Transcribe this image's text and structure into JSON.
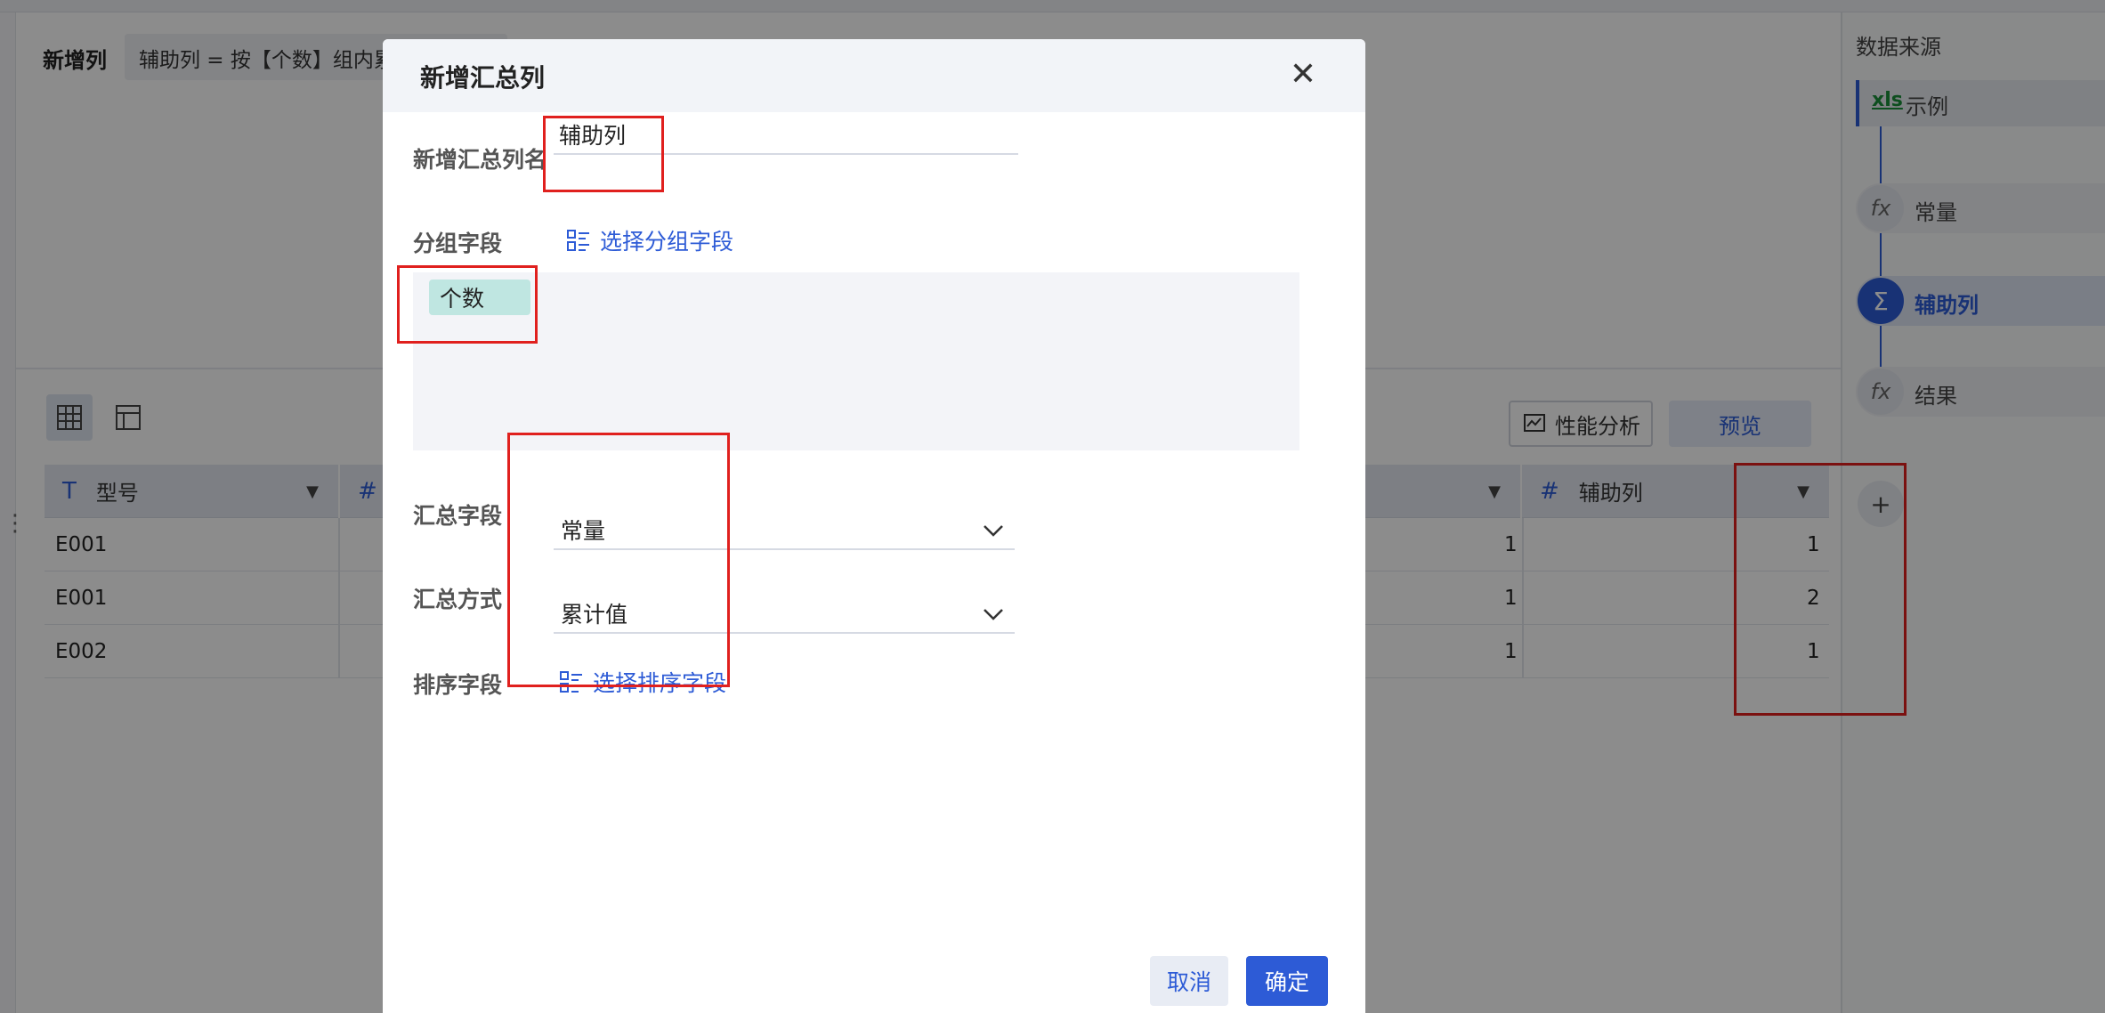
{
  "editor": {
    "formula_label": "新增列",
    "formula_text": "辅助列 = 按【个数】组内累计常量"
  },
  "table": {
    "columns": [
      {
        "type_icon": "T",
        "name": "型号"
      },
      {
        "type_icon": "#",
        "name": ""
      },
      {
        "type_icon": "#",
        "name": "辅助列"
      }
    ],
    "rows": [
      {
        "model": "E001",
        "hidden_value": "1",
        "helper": "1"
      },
      {
        "model": "E001",
        "hidden_value": "1",
        "helper": "2"
      },
      {
        "model": "E002",
        "hidden_value": "1",
        "helper": "1"
      }
    ]
  },
  "toolbar": {
    "perf_label": "性能分析",
    "preview_label": "预览"
  },
  "right_panel": {
    "title": "数据来源",
    "steps": [
      {
        "icon": "xls-icon",
        "label": "示例"
      },
      {
        "icon": "fx-icon",
        "label": "常量"
      },
      {
        "icon": "sigma-icon",
        "label": "辅助列"
      },
      {
        "icon": "fx-icon",
        "label": "结果"
      }
    ],
    "add_label": "+"
  },
  "modal": {
    "title": "新增汇总列",
    "name_label": "新增汇总列名",
    "name_value": "辅助列",
    "group_label": "分组字段",
    "group_link": "选择分组字段",
    "group_tags": [
      "个数"
    ],
    "agg_field_label": "汇总字段",
    "agg_field_value": "常量",
    "agg_method_label": "汇总方式",
    "agg_method_value": "累计值",
    "sort_label": "排序字段",
    "sort_link": "选择排序字段",
    "cancel_label": "取消",
    "ok_label": "确定"
  },
  "colors": {
    "accent": "#2d5bd6",
    "highlight": "#e0201e",
    "tag_bg": "#bfe6e1"
  }
}
